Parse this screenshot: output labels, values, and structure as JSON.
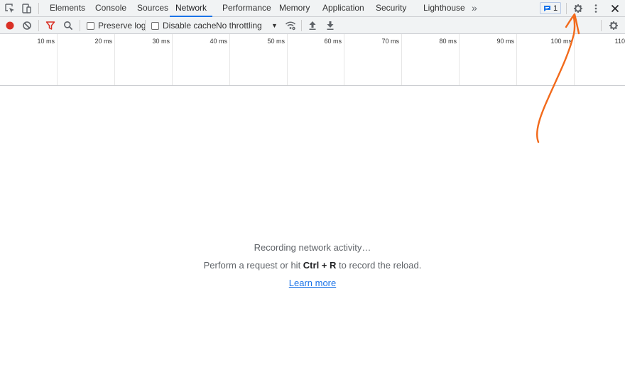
{
  "tabs": [
    {
      "label": "Elements"
    },
    {
      "label": "Console"
    },
    {
      "label": "Sources"
    },
    {
      "label": "Network"
    },
    {
      "label": "Performance"
    },
    {
      "label": "Memory"
    },
    {
      "label": "Application"
    },
    {
      "label": "Security"
    },
    {
      "label": "Lighthouse"
    }
  ],
  "more_tabs": "»",
  "issues": {
    "count": "1"
  },
  "toolbar": {
    "preserve_log": "Preserve log",
    "disable_cache": "Disable cache",
    "throttling": "No throttling",
    "throttling_arrow": "▼"
  },
  "timeline": {
    "ticks": [
      "10 ms",
      "20 ms",
      "30 ms",
      "40 ms",
      "50 ms",
      "60 ms",
      "70 ms",
      "80 ms",
      "90 ms",
      "100 ms",
      "110"
    ]
  },
  "empty_state": {
    "recording": "Recording network activity…",
    "hint_prefix": "Perform a request or hit ",
    "hint_shortcut": "Ctrl + R",
    "hint_suffix": " to record the reload.",
    "learn_more": "Learn more"
  },
  "colors": {
    "accent": "#1a73e8",
    "record": "#d93025",
    "filter": "#d93025",
    "annotation": "#f26a1b"
  }
}
